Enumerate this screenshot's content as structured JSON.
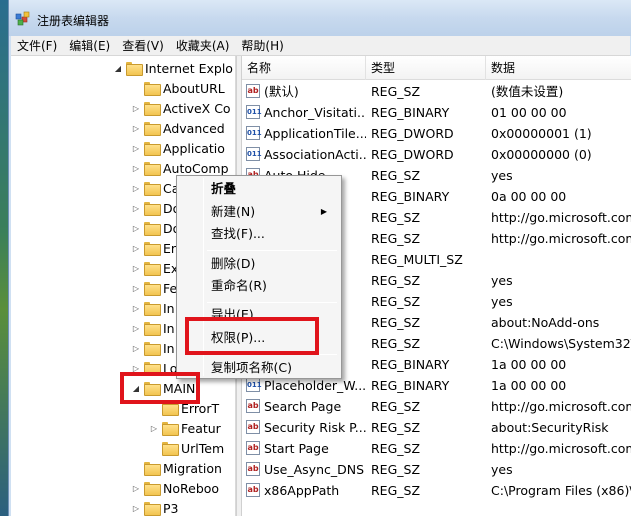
{
  "window": {
    "title": "注册表编辑器"
  },
  "menu": [
    "文件(F)",
    "编辑(E)",
    "查看(V)",
    "收藏夹(A)",
    "帮助(H)"
  ],
  "tree": [
    {
      "label": "Internet Explo",
      "indent": 0,
      "arrow": "open"
    },
    {
      "label": "AboutURL",
      "indent": 1,
      "arrow": "none"
    },
    {
      "label": "ActiveX Co",
      "indent": 1,
      "arrow": "closed"
    },
    {
      "label": "Advanced",
      "indent": 1,
      "arrow": "closed"
    },
    {
      "label": "Applicatio",
      "indent": 1,
      "arrow": "closed"
    },
    {
      "label": "AutoComp",
      "indent": 1,
      "arrow": "closed"
    },
    {
      "label": "Ca",
      "indent": 1,
      "arrow": "closed"
    },
    {
      "label": "Do",
      "indent": 1,
      "arrow": "closed"
    },
    {
      "label": "Do",
      "indent": 1,
      "arrow": "closed"
    },
    {
      "label": "Er",
      "indent": 1,
      "arrow": "closed"
    },
    {
      "label": "Ex",
      "indent": 1,
      "arrow": "closed"
    },
    {
      "label": "Fe",
      "indent": 1,
      "arrow": "closed"
    },
    {
      "label": "In",
      "indent": 1,
      "arrow": "closed"
    },
    {
      "label": "In",
      "indent": 1,
      "arrow": "closed"
    },
    {
      "label": "In",
      "indent": 1,
      "arrow": "closed"
    },
    {
      "label": "Lo",
      "indent": 1,
      "arrow": "closed"
    },
    {
      "label": "MAIN",
      "indent": 1,
      "arrow": "open"
    },
    {
      "label": "ErrorT",
      "indent": 2,
      "arrow": "none"
    },
    {
      "label": "Featur",
      "indent": 2,
      "arrow": "closed"
    },
    {
      "label": "UrlTem",
      "indent": 2,
      "arrow": "none"
    },
    {
      "label": "Migration",
      "indent": 1,
      "arrow": "none"
    },
    {
      "label": "NoReboo",
      "indent": 1,
      "arrow": "closed"
    },
    {
      "label": "P3",
      "indent": 1,
      "arrow": "closed"
    }
  ],
  "columns": {
    "name": "名称",
    "type": "类型",
    "data": "数据"
  },
  "values": [
    {
      "icon": "ab",
      "name": "(默认)",
      "type": "REG_SZ",
      "data": "(数值未设置)"
    },
    {
      "icon": "bin",
      "name": "Anchor_Visitati...",
      "type": "REG_BINARY",
      "data": "01 00 00 00"
    },
    {
      "icon": "bin",
      "name": "ApplicationTile...",
      "type": "REG_DWORD",
      "data": "0x00000001 (1)"
    },
    {
      "icon": "bin",
      "name": "AssociationActi...",
      "type": "REG_DWORD",
      "data": "0x00000000 (0)"
    },
    {
      "icon": "ab",
      "name": "Auto Hide",
      "type": "REG_SZ",
      "data": "yes"
    },
    {
      "icon": "bin",
      "name": "...nt...",
      "type": "REG_BINARY",
      "data": "0a 00 00 00"
    },
    {
      "icon": "ab",
      "name": "...",
      "type": "REG_SZ",
      "data": "http://go.microsoft.com/"
    },
    {
      "icon": "ab",
      "name": "...ch...",
      "type": "REG_SZ",
      "data": "http://go.microsoft.com/"
    },
    {
      "icon": "ab",
      "name": "...",
      "type": "REG_MULTI_SZ",
      "data": ""
    },
    {
      "icon": "ab",
      "name": "..._F...",
      "type": "REG_SZ",
      "data": "yes"
    },
    {
      "icon": "ab",
      "name": "..._C...",
      "type": "REG_SZ",
      "data": "yes"
    },
    {
      "icon": "ab",
      "name": "...ff...",
      "type": "REG_SZ",
      "data": "about:NoAdd-ons"
    },
    {
      "icon": "ab",
      "name": "...",
      "type": "REG_SZ",
      "data": "C:\\Windows\\System32\\b"
    },
    {
      "icon": "bin",
      "name": "...H...",
      "type": "REG_BINARY",
      "data": "1a 00 00 00"
    },
    {
      "icon": "bin",
      "name": "Placeholder_W...",
      "type": "REG_BINARY",
      "data": "1a 00 00 00"
    },
    {
      "icon": "ab",
      "name": "Search Page",
      "type": "REG_SZ",
      "data": "http://go.microsoft.com/"
    },
    {
      "icon": "ab",
      "name": "Security Risk P...",
      "type": "REG_SZ",
      "data": "about:SecurityRisk"
    },
    {
      "icon": "ab",
      "name": "Start Page",
      "type": "REG_SZ",
      "data": "http://go.microsoft.com/"
    },
    {
      "icon": "ab",
      "name": "Use_Async_DNS",
      "type": "REG_SZ",
      "data": "yes"
    },
    {
      "icon": "ab",
      "name": "x86AppPath",
      "type": "REG_SZ",
      "data": "C:\\Program Files (x86)\\In"
    }
  ],
  "context_menu": {
    "collapse": "折叠",
    "new": "新建(N)",
    "find": "查找(F)...",
    "delete": "删除(D)",
    "rename": "重命名(R)",
    "export": "导出(E)",
    "permissions": "权限(P)...",
    "copy_key_name": "复制项名称(C)"
  },
  "colors": {
    "highlight": "#e0141b"
  }
}
